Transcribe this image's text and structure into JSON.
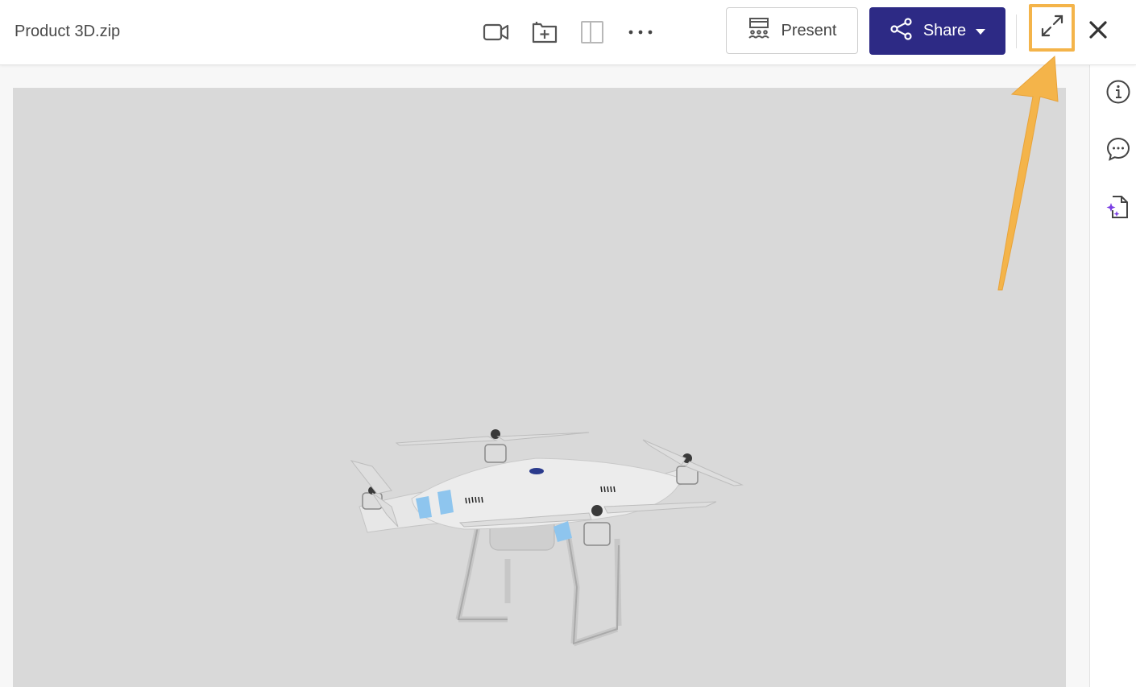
{
  "header": {
    "file_name": "Product 3D.zip",
    "present_label": "Present",
    "share_label": "Share"
  },
  "toolbar_icons": [
    "video-camera-icon",
    "folder-add-icon",
    "split-panel-icon",
    "more-options-icon"
  ],
  "sidebar_icons": [
    "info-icon",
    "comment-icon",
    "ai-document-icon"
  ],
  "colors": {
    "share_button": "#2d2a85",
    "highlight": "#f4b44a",
    "viewer_background": "#d9d9d9",
    "ai_accent": "#7b3fe4"
  }
}
